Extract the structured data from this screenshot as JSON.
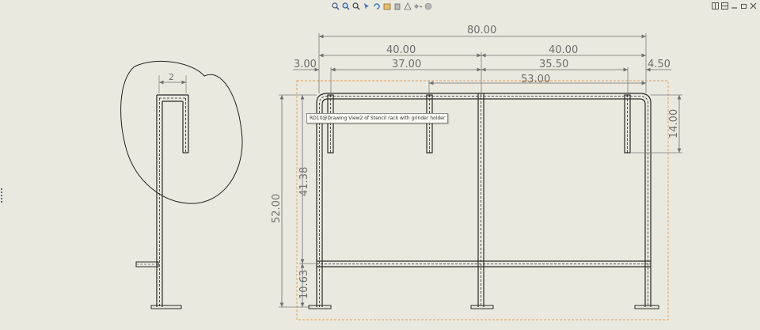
{
  "toolbar": {
    "icons": [
      "zoom-to-fit-icon",
      "zoom-to-area-icon",
      "zoom-in-out-icon",
      "select-icon",
      "rebuild-icon",
      "view-orientation-icon",
      "display-style-icon",
      "section-view-icon",
      "view-settings-icon",
      "appearance-icon"
    ]
  },
  "window_controls": [
    "tile-horizontal-icon",
    "tile-vertical-icon",
    "minimize-icon",
    "restore-icon",
    "close-icon"
  ],
  "dimensions": {
    "overall_width": "80.00",
    "left_span": "40.00",
    "right_span": "40.00",
    "left_offset": "3.00",
    "left_inner": "37.00",
    "right_inner": "35.50",
    "right_offset": "4.50",
    "middle_span": "53.00",
    "right_post_height": "14.00",
    "overall_height": "52.00",
    "upper_height": "41.38",
    "lower_height": "10.63",
    "side_detail": "2"
  },
  "tooltip": {
    "text": "RD10@Drawing View2 of Stencil rack with grinder holder"
  },
  "colors": {
    "sheet_background": "#e9e9df",
    "geometry": "#2a2a2a",
    "dimension": "#7b7b7b",
    "view_boundary": "#e39a5a"
  }
}
